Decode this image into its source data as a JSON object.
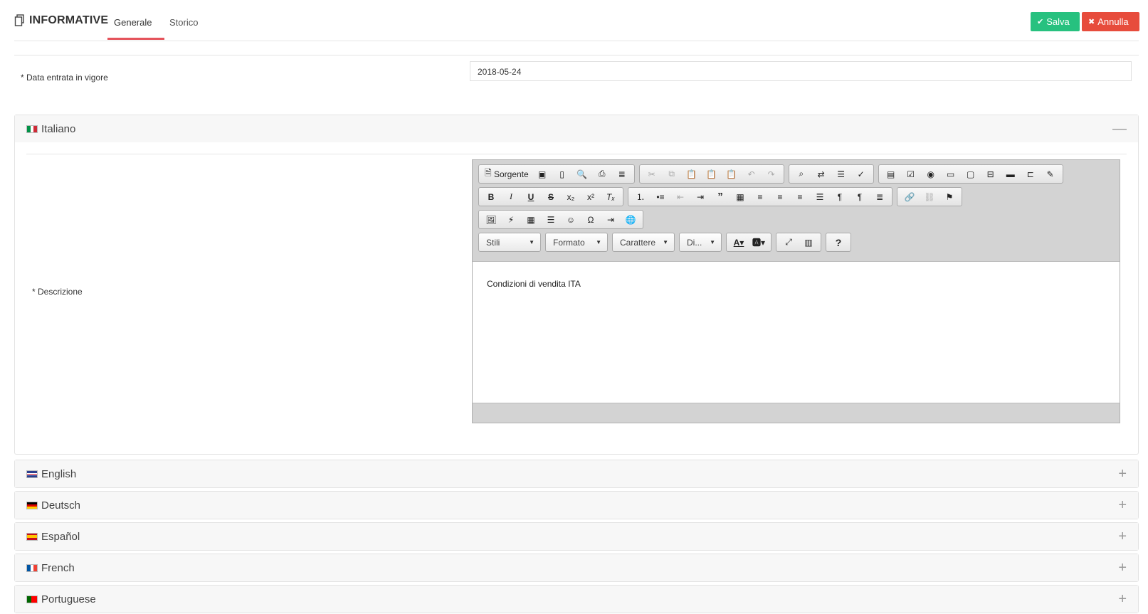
{
  "header": {
    "title": "INFORMATIVE",
    "tabs": [
      {
        "label": "Generale"
      },
      {
        "label": "Storico"
      }
    ],
    "save_label": "Salva",
    "cancel_label": "Annulla"
  },
  "form": {
    "effective_date_label": "* Data entrata in vigore",
    "effective_date_value": "2018-05-24",
    "description_label": "* Descrizione"
  },
  "languages": [
    {
      "label": "Italiano",
      "toggle": "—"
    },
    {
      "label": "English",
      "toggle": "+"
    },
    {
      "label": "Deutsch",
      "toggle": "+"
    },
    {
      "label": "Español",
      "toggle": "+"
    },
    {
      "label": "French",
      "toggle": "+"
    },
    {
      "label": "Portuguese",
      "toggle": "+"
    }
  ],
  "editor": {
    "source_label": "Sorgente",
    "combos": [
      "Stili",
      "Formato",
      "Carattere",
      "Di..."
    ],
    "content": "Condizioni di vendita ITA"
  },
  "colors": {
    "save": "#27c17f",
    "cancel": "#e74c3c",
    "tab_accent": "#e5535b"
  }
}
